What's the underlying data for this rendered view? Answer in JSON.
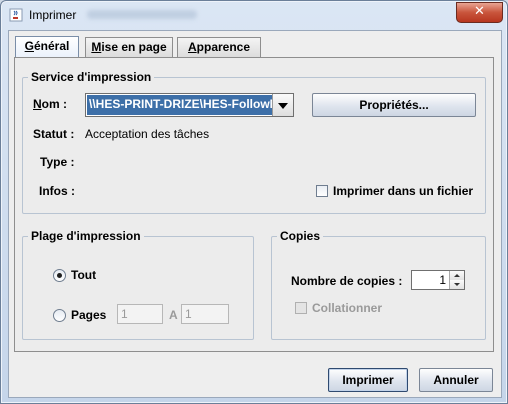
{
  "window": {
    "title": "Imprimer"
  },
  "tabs": [
    {
      "label": "Général",
      "mnemonic": "G",
      "rest": "énéral"
    },
    {
      "label": "Mise en page",
      "mnemonic": "M",
      "rest": "ise en page"
    },
    {
      "label": "Apparence",
      "mnemonic": "A",
      "rest": "pparence"
    }
  ],
  "service": {
    "group_title": "Service d'impression",
    "nom_label": "Nom :",
    "nom_value": "\\\\HES-PRINT-DRIZE\\HES-FollowMe",
    "properties_button": "Propriétés...",
    "statut_label": "Statut :",
    "statut_value": "Acceptation des tâches",
    "type_label": "Type :",
    "infos_label": "Infos :",
    "print_to_file_label": "Imprimer dans un fichier"
  },
  "range": {
    "group_title": "Plage d'impression",
    "all_label": "Tout",
    "pages_label": "Pages",
    "from_value": "1",
    "to_label": "A",
    "to_value": "1"
  },
  "copies": {
    "group_title": "Copies",
    "count_label": "Nombre de copies :",
    "count_value": "1",
    "collate_label": "Collationner"
  },
  "footer": {
    "print_button": "Imprimer",
    "cancel_button": "Annuler"
  },
  "colors": {
    "selection": "#3d6fa8",
    "close_button": "#c9553c"
  }
}
